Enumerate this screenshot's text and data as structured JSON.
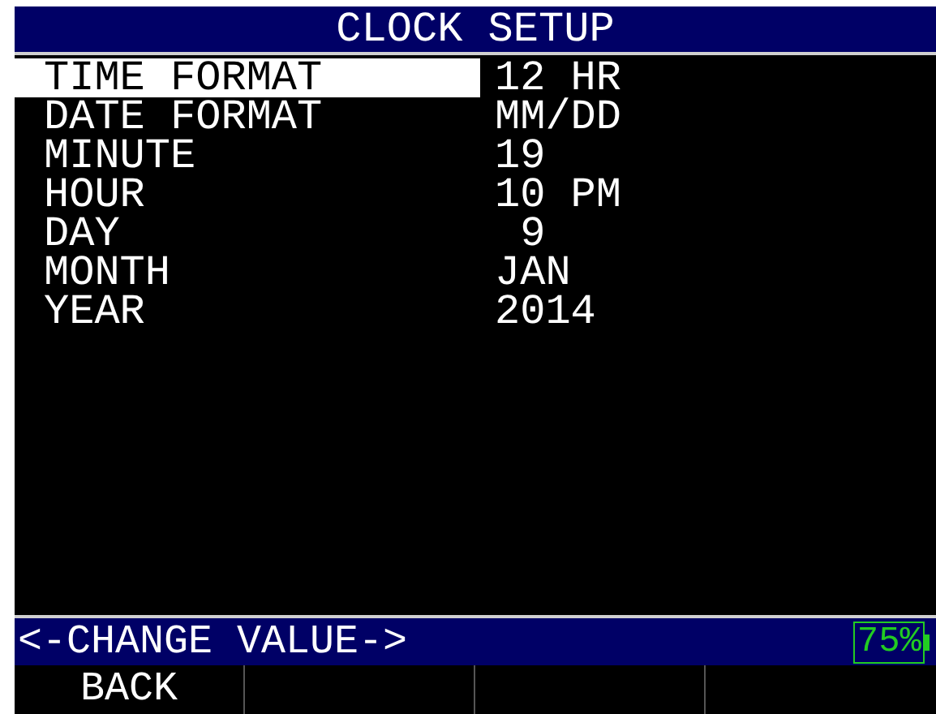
{
  "title": "CLOCK SETUP",
  "rows": [
    {
      "label": "TIME FORMAT",
      "value": "12 HR",
      "selected": true
    },
    {
      "label": "DATE FORMAT",
      "value": "MM/DD",
      "selected": false
    },
    {
      "label": "MINUTE",
      "value": "19",
      "selected": false
    },
    {
      "label": "HOUR",
      "value": "10 PM",
      "selected": false
    },
    {
      "label": "DAY",
      "value": " 9",
      "selected": false
    },
    {
      "label": "MONTH",
      "value": "JAN",
      "selected": false
    },
    {
      "label": "YEAR",
      "value": "2014",
      "selected": false
    }
  ],
  "status_bar": {
    "hint": "<-CHANGE VALUE->",
    "battery": "75%"
  },
  "soft_keys": [
    "BACK"
  ]
}
